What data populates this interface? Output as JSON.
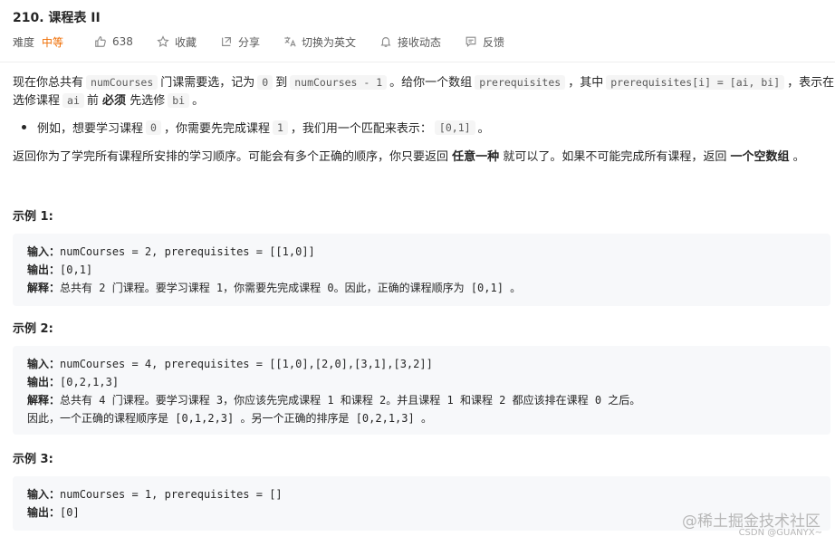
{
  "problem": {
    "title": "210. 课程表 II",
    "difficulty_label": "难度",
    "difficulty": "中等",
    "likes": "638",
    "favorite_label": "收藏",
    "share_label": "分享",
    "translate_label": "切换为英文",
    "notify_label": "接收动态",
    "feedback_label": "反馈"
  },
  "description": {
    "p1_a": "现在你总共有",
    "p1_code1": "numCourses",
    "p1_b": "门课需要选，记为",
    "p1_code2": "0",
    "p1_c": "到",
    "p1_code3": "numCourses - 1",
    "p1_d": "。给你一个数组",
    "p1_code4": "prerequisites",
    "p1_e": "，其中",
    "p1_code5": "prerequisites[i] = [ai, bi]",
    "p1_f": "，表示在",
    "p1_line2_a": "选修课程",
    "p1_code6": "ai",
    "p1_line2_b": "前",
    "p1_bold1": "必须",
    "p1_line2_c": "先选修",
    "p1_code7": "bi",
    "p1_line2_d": "。",
    "bullet_a": "例如，想要学习课程",
    "bullet_code1": "0",
    "bullet_b": "，你需要先完成课程",
    "bullet_code2": "1",
    "bullet_c": "，我们用一个匹配来表示：",
    "bullet_code3": "[0,1]",
    "bullet_d": "。",
    "p2_a": "返回你为了学完所有课程所安排的学习顺序。可能会有多个正确的顺序，你只要返回",
    "p2_bold1": "任意一种",
    "p2_b": "就可以了。如果不可能完成所有课程，返回",
    "p2_bold2": "一个空数组",
    "p2_c": "。"
  },
  "examples": [
    {
      "heading": "示例 1:",
      "input_label": "输入：",
      "input": "numCourses = 2, prerequisites = [[1,0]]",
      "output_label": "输出：",
      "output": "[0,1]",
      "explain_label": "解释：",
      "explain": "总共有 2 门课程。要学习课程 1，你需要先完成课程 0。因此，正确的课程顺序为 [0,1] 。"
    },
    {
      "heading": "示例 2:",
      "input_label": "输入：",
      "input": "numCourses = 4, prerequisites = [[1,0],[2,0],[3,1],[3,2]]",
      "output_label": "输出：",
      "output": "[0,2,1,3]",
      "explain_label": "解释：",
      "explain": "总共有 4 门课程。要学习课程 3，你应该先完成课程 1 和课程 2。并且课程 1 和课程 2 都应该排在课程 0 之后。",
      "explain_2": "因此，一个正确的课程顺序是 [0,1,2,3] 。另一个正确的排序是 [0,2,1,3] 。"
    },
    {
      "heading": "示例 3:",
      "input_label": "输入：",
      "input": "numCourses = 1, prerequisites = []",
      "output_label": "输出：",
      "output": "[0]"
    }
  ],
  "watermark": {
    "main": "@稀土掘金技术社区",
    "sub": "CSDN @GUANYX~"
  },
  "colors": {
    "difficulty": "#ef6c00",
    "code_bg": "#f7f8fa",
    "inline_code_bg": "#f5f5f5"
  },
  "icons": [
    "thumbs-up-icon",
    "star-icon",
    "share-icon",
    "translate-icon",
    "bell-icon",
    "feedback-icon"
  ]
}
